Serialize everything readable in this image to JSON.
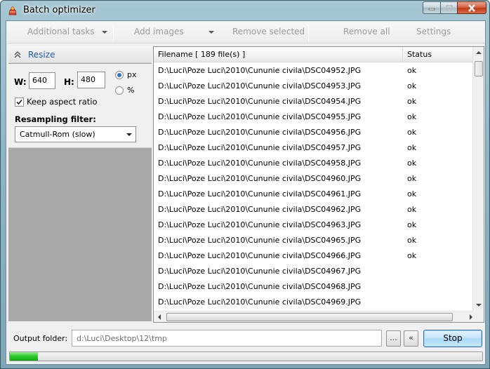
{
  "window": {
    "title": "Batch optimizer"
  },
  "toolbar": {
    "additional_tasks": "Additional tasks",
    "add_images": "Add images",
    "remove_selected": "Remove selected",
    "remove_all": "Remove all",
    "settings": "Settings"
  },
  "resize": {
    "title": "Resize",
    "w_label": "W:",
    "w_value": "640",
    "h_label": "H:",
    "h_value": "480",
    "unit_px": "px",
    "unit_pct": "%",
    "selected_unit": "px",
    "keep_aspect_label": "Keep aspect ratio",
    "keep_aspect_checked": true,
    "filter_label": "Resampling filter:",
    "filter_value": "Catmull-Rom (slow)"
  },
  "list": {
    "col_filename": "Filename [ 189 file(s) ]",
    "col_status": "Status",
    "rows": [
      {
        "file": "D:\\Luci\\Poze Luci\\2010\\Cununie civila\\DSC04952.JPG",
        "status": "ok"
      },
      {
        "file": "D:\\Luci\\Poze Luci\\2010\\Cununie civila\\DSC04953.JPG",
        "status": "ok"
      },
      {
        "file": "D:\\Luci\\Poze Luci\\2010\\Cununie civila\\DSC04954.JPG",
        "status": "ok"
      },
      {
        "file": "D:\\Luci\\Poze Luci\\2010\\Cununie civila\\DSC04955.JPG",
        "status": "ok"
      },
      {
        "file": "D:\\Luci\\Poze Luci\\2010\\Cununie civila\\DSC04956.JPG",
        "status": "ok"
      },
      {
        "file": "D:\\Luci\\Poze Luci\\2010\\Cununie civila\\DSC04957.JPG",
        "status": "ok"
      },
      {
        "file": "D:\\Luci\\Poze Luci\\2010\\Cununie civila\\DSC04958.JPG",
        "status": "ok"
      },
      {
        "file": "D:\\Luci\\Poze Luci\\2010\\Cununie civila\\DSC04960.JPG",
        "status": "ok"
      },
      {
        "file": "D:\\Luci\\Poze Luci\\2010\\Cununie civila\\DSC04961.JPG",
        "status": "ok"
      },
      {
        "file": "D:\\Luci\\Poze Luci\\2010\\Cununie civila\\DSC04962.JPG",
        "status": "ok"
      },
      {
        "file": "D:\\Luci\\Poze Luci\\2010\\Cununie civila\\DSC04963.JPG",
        "status": "ok"
      },
      {
        "file": "D:\\Luci\\Poze Luci\\2010\\Cununie civila\\DSC04965.JPG",
        "status": "ok"
      },
      {
        "file": "D:\\Luci\\Poze Luci\\2010\\Cununie civila\\DSC04966.JPG",
        "status": "ok"
      },
      {
        "file": "D:\\Luci\\Poze Luci\\2010\\Cununie civila\\DSC04967.JPG",
        "status": ""
      },
      {
        "file": "D:\\Luci\\Poze Luci\\2010\\Cununie civila\\DSC04968.JPG",
        "status": ""
      },
      {
        "file": "D:\\Luci\\Poze Luci\\2010\\Cununie civila\\DSC04969.JPG",
        "status": ""
      }
    ]
  },
  "output": {
    "label": "Output folder:",
    "path": "d:\\Luci\\Desktop\\12\\tmp",
    "browse_label": "...",
    "back_label": "«",
    "stop_label": "Stop"
  },
  "progress": {
    "fraction": 0.06
  },
  "colors": {
    "accent": "#1e5aa8",
    "progress": "#2fcc2f",
    "close": "#c23a18"
  }
}
